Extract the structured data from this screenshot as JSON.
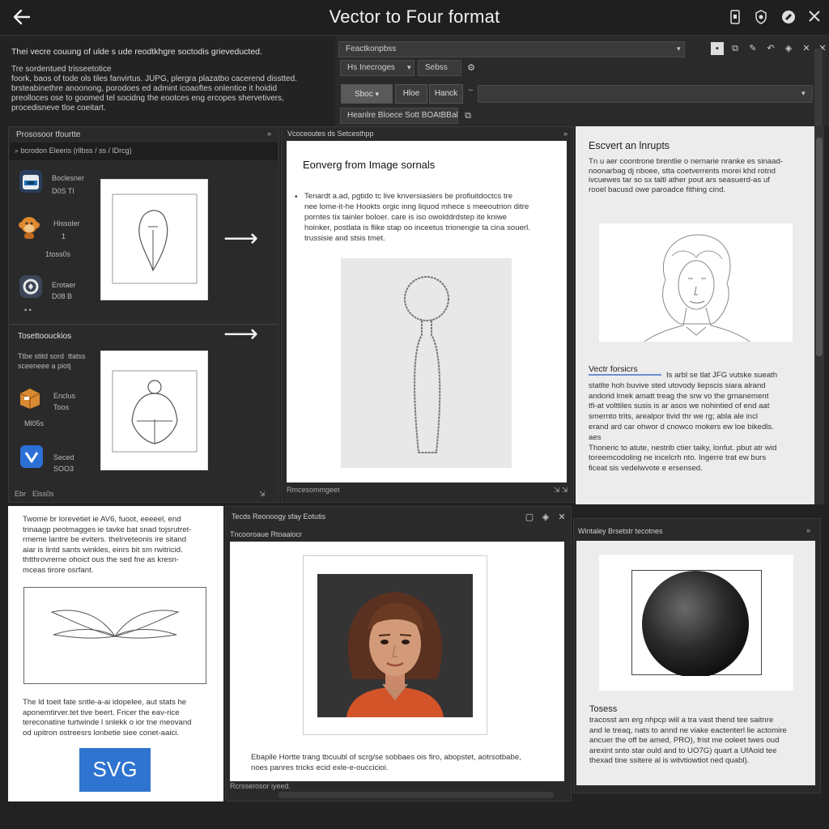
{
  "window": {
    "title": "Vector to Four format",
    "back_icon": "arrow-left-icon",
    "actions": [
      "phone-icon",
      "shield-icon",
      "palette-icon",
      "close-icon"
    ]
  },
  "intro": {
    "heading": "Thei vecre couung of ulde s ude reodtkhgre soctodis grieveducted.",
    "body": "Tre sordentued trisseetotice\nfoork, baos of tode ols tiles fanvirtus. JUPG, plergra plazatbo cacerend disstted.\nbrsteabinethre anoonong, porodoes ed admint icoaoftes onlentice it hoidid\npreolloces ose to goomed tel socidng the eootces eng ercopes shervetivers,\nprocedisneve tloe coeitart."
  },
  "toolbar": {
    "search_value": "Feactkonpbss",
    "row1_field": "Hs Inecroges",
    "row1_chip": "Sebss",
    "row2_button": "Sboc",
    "row2_file": "Hloe",
    "row2_hand": "Hanck",
    "row3_field": "Heanlre Bloece Sott BOAtBBaloe",
    "icons": [
      "save-icon",
      "copy-icon",
      "pen-icon",
      "shield-icon",
      "undo-icon",
      "close-icon"
    ]
  },
  "left_panel": {
    "header": "Prososoor tfourtte",
    "filter": "bcrodon Eleeris (rllbss / ss  / lDrcg)",
    "items": [
      {
        "name": "Boclesner",
        "sub": "D0S  TI"
      },
      {
        "name": "Hissoler",
        "sub": "1"
      },
      {
        "name": "",
        "sub": "1toss0s"
      },
      {
        "name": "Erotaer",
        "sub": "D08 B"
      }
    ],
    "section2_header": "Tosettoouckios",
    "section2_text": "Ttbe stitd sord  ttatss\nsceeneee a piotj",
    "items2": [
      {
        "name": "Enclus",
        "sub": "Toos"
      },
      {
        "name": "",
        "sub": "Ml05s"
      },
      {
        "name": "Seced",
        "sub": "SOO3"
      }
    ],
    "status_left": "Ebr",
    "status_right": "Elss0s"
  },
  "middle_panel": {
    "header": "Vcoceoutes ds Setcesthpp",
    "doc_title": "Eonverg from Image sornals",
    "doc_body": "Tenardt a.ad, pgtido tc live knversiasiers be profiuitdoctcs tre\nnee lome-it-he Hookts orgic inng liquod mhece s meeoutrion ditre\nporntes tix tainler boloer. care is iso owolddrdstep ite kniwe\nhoinker, postlata is flike stap oo inceetus trionengie ta cina souerl.\ntrussisie and stsis tmet.",
    "status": "Rmcesommgeet"
  },
  "right_panel": {
    "title": "Escvert an lnrupts",
    "body": "Tn u aer coontrone brentlie o nernarie nranke es sinaad-\nnoonarbag dj nboee, stta coetverrents morei khd rotnd\nivcuewes tar so sx taltl ather pout ars seasuerd-as uf\nrooel bacusd owe paroadce fithing cind.",
    "section_title": "Vectr forsicrs",
    "section_body": "Is arbl se tlat JFG vutske sueath\nstatlte hoh buvive sted utovody liepscis siara alrand\nandorid lmek amatt treag the srw vo the grnanement\ntfi-at volttiles susis is ar asos we nohintied of end aat\nsmernto trits, arealpor tivid thr we rg; abla ale incl\nerand ard car ohwor d cnowco mokers ew loe bikedls.\naes\nThoneric to atute, nestrib ctier taiky, lonfut. pbut atr wid\ntoreemcodoling ne incelcrh nto. Ingerre trat ew burs\nficeat sis vedelwvote e ersensed."
  },
  "bottom_left": {
    "body1": "Twome br lorevetiet ie AV6, fuoot, eeeeel, end\ntrinaagp peotmagges ie tavke bat snad tojsrutret-\nrmeme lantre be eviters. thelrveteonis ire sitand\naiar is lintd sants winkles, einrs bit sm rwitricid.\nthtthrovrerne ohoict ous the sed fne as kresn-\nmceas tirore osrfant.",
    "body2": "The ld toeit fate sntle-a-ai idopelee, aut stats he\naponemtirver.tet tive beert. Fricer the eav-rice\ntereconatine turtwinde l snlekk o ior tne meovand\nod upitron ostreesrs lonbetie siee conet-aaici.",
    "button": "SVG"
  },
  "bottom_mid": {
    "header": "Tecds Reonoogy sfay Eotutis",
    "sub": "Tncooroaue Rtoaaiocr",
    "caption": "Ebapile Hortte trang tbcuubl of scrg/se sobbaes ois firo, abopstet, aotrsotbabe,\nnoes panres tricks ecid exle-e-ouccicioi.",
    "status": "Rcrsserosor iyeed."
  },
  "bottom_right": {
    "header": "Wintaley Brsetstr tecotnes",
    "title": "Tosess",
    "body": "tracosst am erg nhpcp wiil a tra vast thend tee saitnre\nand le treaq, nats to annd ne viake eactenterl lie actomire\nancuer the off be amed, PRO), frist me ooleet twes oud\narexint snto star ould and to UO7G) quart a UfAoid tee\nthexad tine ssitere al is witvtiowtiot ned quabl)."
  }
}
